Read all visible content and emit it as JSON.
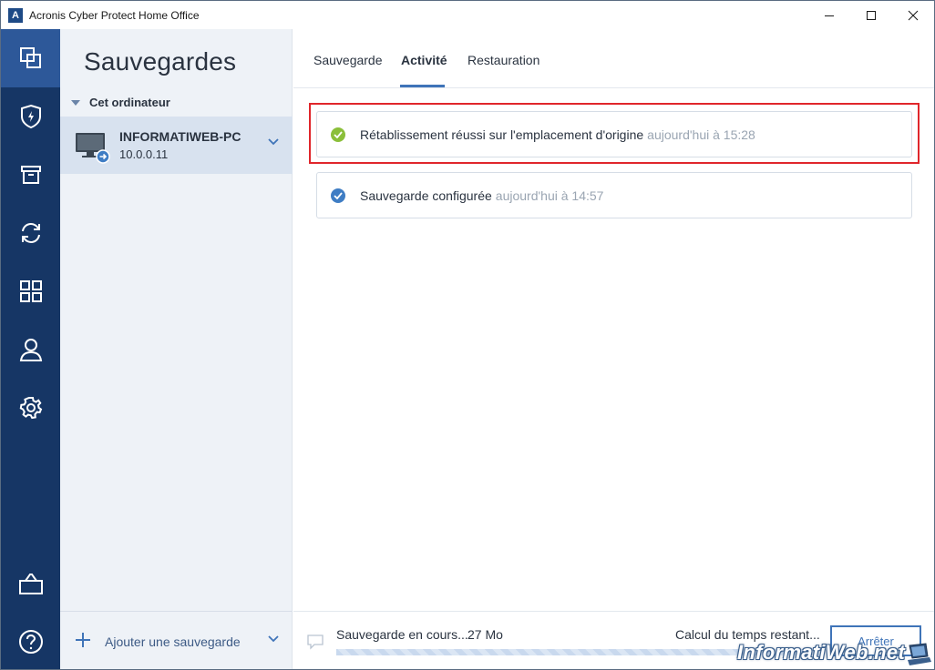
{
  "window": {
    "title": "Acronis Cyber Protect Home Office",
    "logo_letter": "A"
  },
  "nav": {
    "items": [
      {
        "name": "backups",
        "icon": "copy-icon",
        "active": true
      },
      {
        "name": "protection",
        "icon": "shield-bolt-icon"
      },
      {
        "name": "archive",
        "icon": "archive-box-icon"
      },
      {
        "name": "sync",
        "icon": "sync-arrows-icon"
      },
      {
        "name": "tools",
        "icon": "grid-icon"
      },
      {
        "name": "account",
        "icon": "user-icon"
      },
      {
        "name": "settings",
        "icon": "gear-icon"
      },
      {
        "name": "store",
        "icon": "shopping-bag-icon"
      },
      {
        "name": "help",
        "icon": "help-circle-icon"
      }
    ]
  },
  "sidebar": {
    "title": "Sauvegardes",
    "group_label": "Cet ordinateur",
    "machine": {
      "name": "INFORMATIWEB-PC",
      "ip": "10.0.0.11"
    },
    "add_backup_label": "Ajouter une sauvegarde"
  },
  "tabs": [
    {
      "label": "Sauvegarde"
    },
    {
      "label": "Activité",
      "active": true
    },
    {
      "label": "Restauration"
    }
  ],
  "activity": [
    {
      "message": "Rétablissement réussi sur l'emplacement d'origine",
      "time": "aujourd'hui à 15:28",
      "status": "success",
      "status_color": "#8bbf3a",
      "highlighted": true
    },
    {
      "message": "Sauvegarde configurée",
      "time": "aujourd'hui à 14:57",
      "status": "info",
      "status_color": "#3f7dc4"
    }
  ],
  "progress": {
    "label": "Sauvegarde en cours...",
    "size": "27 Mo",
    "remaining": "Calcul du temps restant...",
    "fraction": 1.0,
    "stop_label": "Arrêter"
  },
  "watermark": "InformatiWeb.net",
  "colors": {
    "nav_bg": "#163665",
    "nav_active": "#2d5899",
    "accent": "#3f74b8",
    "highlight_border": "#e0262b"
  }
}
